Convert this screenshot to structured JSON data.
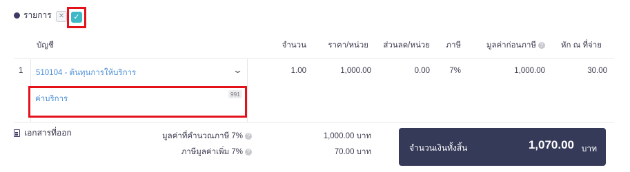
{
  "section": {
    "title": "รายการ",
    "close_glyph": "✕",
    "check_glyph": "✓"
  },
  "table": {
    "headers": {
      "account": "บัญชี",
      "qty": "จำนวน",
      "price": "ราคา/หน่วย",
      "discount": "ส่วนลด/หน่วย",
      "vat": "ภาษี",
      "pre_vat": "มูลค่าก่อนภาษี",
      "withholding": "หัก ณ ที่จ่าย"
    },
    "help_glyph": "?",
    "rows": [
      {
        "num": "1",
        "account": "510104 - ต้นทุนการให้บริการ",
        "chevron": "⌄",
        "description": "ค่าบริการ",
        "char_count": "991",
        "qty": "1.00",
        "price": "1,000.00",
        "discount": "0.00",
        "vat": "7%",
        "pre_vat": "1,000.00",
        "withholding": "30.00"
      }
    ]
  },
  "documents": {
    "title": "เอกสารที่ออก"
  },
  "summary": {
    "vat_base_label": "มูลค่าที่คำนวณภาษี 7%",
    "vat_base_value": "1,000.00 บาท",
    "vat_label": "ภาษีมูลค่าเพิ่ม 7%",
    "vat_value": "70.00 บาท",
    "total_label": "จำนวนเงินทั้งสิ้น",
    "total_amount": "1,070.00",
    "total_unit": "บาท"
  },
  "colors": {
    "accent_dark": "#363a59",
    "link": "#4a8dd6",
    "highlight": "#e3111a",
    "check": "#3fb9c6"
  }
}
